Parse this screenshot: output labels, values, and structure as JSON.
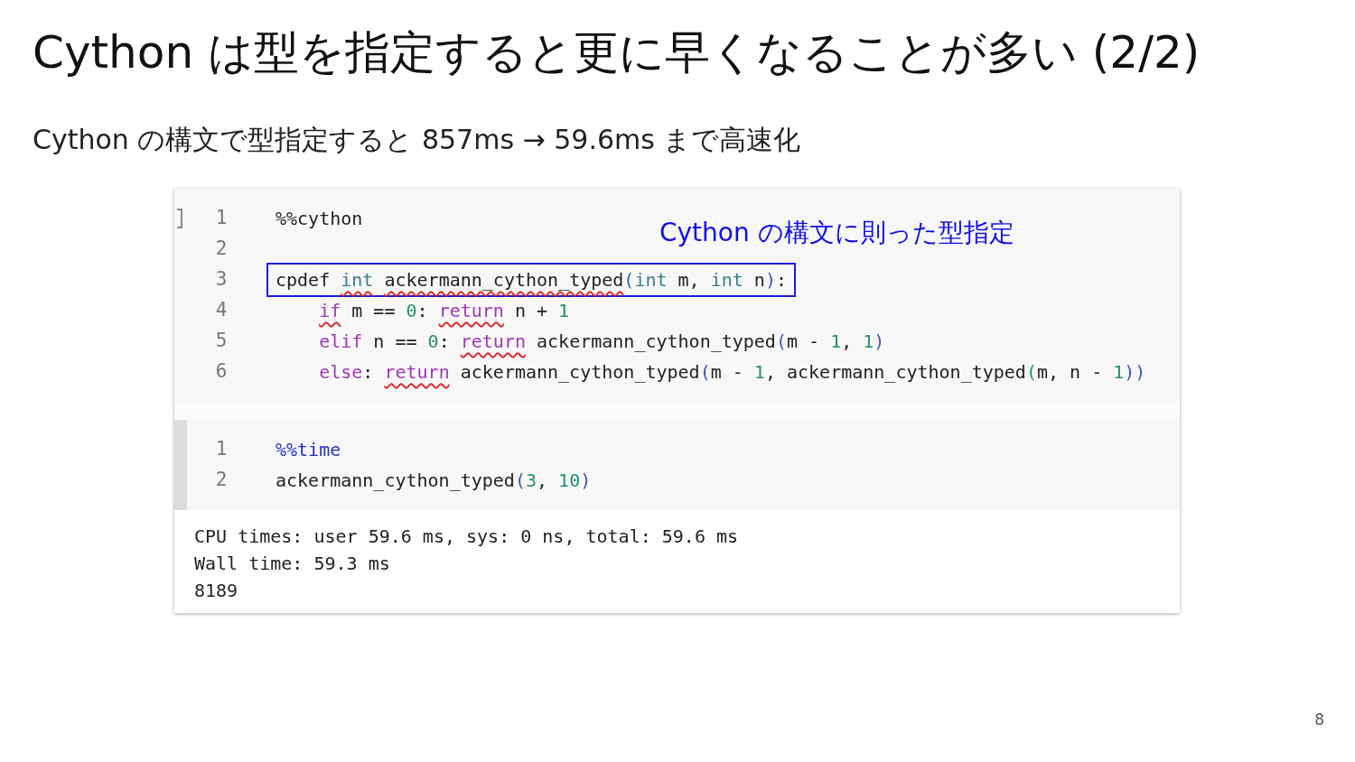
{
  "slide": {
    "title": "Cython は型を指定すると更に早くなることが多い (2/2)",
    "subtitle": "Cython の構文で型指定すると 857ms → 59.6ms まで高速化",
    "page_number": "8"
  },
  "notebook": {
    "cells": [
      {
        "selected": false,
        "annotation": "Cython の構文に則った型指定",
        "lines": [
          {
            "number": "1",
            "tokens": [
              {
                "t": "%%cython",
                "kind": "plain"
              }
            ]
          },
          {
            "number": "2"
          },
          {
            "number": "3",
            "highlighted": true,
            "tokens": [
              {
                "t": "cpdef",
                "kind": "plain"
              },
              {
                "t": " int",
                "kind": "type",
                "squiggle": true
              },
              {
                "t": " ackermann_cython_typed",
                "kind": "plain",
                "squiggle": true
              },
              {
                "t": "(",
                "kind": "paren"
              },
              {
                "t": "int",
                "kind": "type"
              },
              {
                "t": " m, ",
                "kind": "plain"
              },
              {
                "t": "int",
                "kind": "type"
              },
              {
                "t": " n",
                "kind": "plain"
              },
              {
                "t": ")",
                "kind": "paren"
              },
              {
                "t": ":",
                "kind": "plain"
              }
            ]
          },
          {
            "number": "4",
            "indent": true,
            "tokens": [
              {
                "t": "if",
                "kind": "keyword",
                "squiggle": true
              },
              {
                "t": " m == ",
                "kind": "plain"
              },
              {
                "t": "0",
                "kind": "number"
              },
              {
                "t": ": ",
                "kind": "plain"
              },
              {
                "t": "return",
                "kind": "keyword",
                "squiggle": true
              },
              {
                "t": " n + ",
                "kind": "plain"
              },
              {
                "t": "1",
                "kind": "number"
              }
            ]
          },
          {
            "number": "5",
            "indent": true,
            "tokens": [
              {
                "t": "elif",
                "kind": "keyword"
              },
              {
                "t": " n == ",
                "kind": "plain"
              },
              {
                "t": "0",
                "kind": "number"
              },
              {
                "t": ": ",
                "kind": "plain"
              },
              {
                "t": "return",
                "kind": "keyword",
                "squiggle": true
              },
              {
                "t": " ackermann_cython_typed",
                "kind": "plain"
              },
              {
                "t": "(",
                "kind": "paren"
              },
              {
                "t": "m - ",
                "kind": "plain"
              },
              {
                "t": "1",
                "kind": "number"
              },
              {
                "t": ", ",
                "kind": "plain"
              },
              {
                "t": "1",
                "kind": "number"
              },
              {
                "t": ")",
                "kind": "paren"
              }
            ]
          },
          {
            "number": "6",
            "indent": true,
            "tokens": [
              {
                "t": "else",
                "kind": "keyword"
              },
              {
                "t": ": ",
                "kind": "plain"
              },
              {
                "t": "return",
                "kind": "keyword",
                "squiggle": true
              },
              {
                "t": " ackermann_cython_typed",
                "kind": "plain"
              },
              {
                "t": "(",
                "kind": "paren"
              },
              {
                "t": "m - ",
                "kind": "plain"
              },
              {
                "t": "1",
                "kind": "number"
              },
              {
                "t": ", ackermann_cython_typed",
                "kind": "plain"
              },
              {
                "t": "(",
                "kind": "number"
              },
              {
                "t": "m, n - ",
                "kind": "plain"
              },
              {
                "t": "1",
                "kind": "number"
              },
              {
                "t": "))",
                "kind": "paren"
              }
            ]
          }
        ]
      },
      {
        "selected": true,
        "lines": [
          {
            "number": "1",
            "tokens": [
              {
                "t": "%%time",
                "kind": "magic"
              }
            ]
          },
          {
            "number": "2",
            "tokens": [
              {
                "t": "ackermann_cython_typed",
                "kind": "plain"
              },
              {
                "t": "(",
                "kind": "paren"
              },
              {
                "t": "3",
                "kind": "number"
              },
              {
                "t": ", ",
                "kind": "plain"
              },
              {
                "t": "10",
                "kind": "number"
              },
              {
                "t": ")",
                "kind": "paren"
              }
            ]
          }
        ],
        "output": [
          "CPU times: user 59.6 ms, sys: 0 ns, total: 59.6 ms",
          "Wall time: 59.3 ms",
          "8189"
        ]
      }
    ]
  }
}
